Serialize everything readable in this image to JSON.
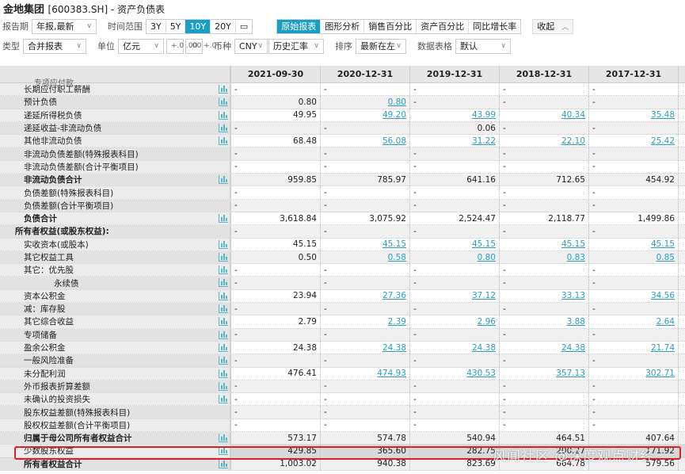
{
  "header": {
    "company": "金地集团",
    "code": "[600383.SH] - 资产负债表"
  },
  "toolbar1": {
    "period_label": "报告期",
    "period_value": "年报,最新",
    "range_label": "时间范围",
    "ranges": [
      "3Y",
      "5Y",
      "10Y",
      "20Y"
    ],
    "active_range": "10Y",
    "views": [
      "原始报表",
      "图形分析",
      "销售百分比",
      "资产百分比",
      "同比增长率"
    ],
    "active_view": "原始报表",
    "collapse": "收起"
  },
  "toolbar2": {
    "type_label": "类型",
    "type_value": "合并报表",
    "unit_label": "单位",
    "unit_value": "亿元",
    "dec_inc": "+.0 .00",
    "dec_dec": ".00 +.0",
    "currency_label": "币种",
    "currency_value": "CNY",
    "rate_value": "历史汇率",
    "sort_label": "排序",
    "sort_value": "最新在左",
    "format_label": "数据表格",
    "format_value": "默认"
  },
  "columns": [
    "2021-09-30",
    "2020-12-31",
    "2019-12-31",
    "2018-12-31",
    "2017-12-31"
  ],
  "partial_row": "专项应付款",
  "rows": [
    {
      "label": "长期应付职工薪酬",
      "icon": true,
      "values": [
        "-",
        "-",
        "-",
        "-",
        "-"
      ]
    },
    {
      "label": "预计负债",
      "icon": true,
      "values": [
        "0.80",
        "0.80",
        "-",
        "-",
        "-"
      ]
    },
    {
      "label": "递延所得税负债",
      "icon": true,
      "values": [
        "49.95",
        "49.20",
        "43.99",
        "40.34",
        "35.48"
      ]
    },
    {
      "label": "递延收益-非流动负债",
      "icon": true,
      "values": [
        "-",
        "-",
        "0.06",
        "-",
        "-"
      ]
    },
    {
      "label": "其他非流动负债",
      "icon": true,
      "values": [
        "68.48",
        "56.08",
        "31.22",
        "22.10",
        "25.42"
      ]
    },
    {
      "label": "非流动负债差额(特殊报表科目)",
      "icon": false,
      "values": [
        "-",
        "-",
        "-",
        "-",
        "-"
      ]
    },
    {
      "label": "非流动负债差额(合计平衡项目)",
      "icon": false,
      "values": [
        "-",
        "-",
        "-",
        "-",
        "-"
      ]
    },
    {
      "label": "非流动负债合计",
      "icon": true,
      "bold": true,
      "values": [
        "959.85",
        "785.97",
        "641.16",
        "712.65",
        "454.92"
      ]
    },
    {
      "label": "负债差额(特殊报表科目)",
      "icon": false,
      "values": [
        "-",
        "-",
        "-",
        "-",
        "-"
      ]
    },
    {
      "label": "负债差额(合计平衡项目)",
      "icon": false,
      "values": [
        "-",
        "-",
        "-",
        "-",
        "-"
      ]
    },
    {
      "label": "负债合计",
      "icon": true,
      "bold": true,
      "values": [
        "3,618.84",
        "3,075.92",
        "2,524.47",
        "2,118.77",
        "1,499.86"
      ]
    },
    {
      "label": "所有者权益(或股东权益):",
      "icon": false,
      "section": true,
      "values": [
        "-",
        "-",
        "-",
        "-",
        "-"
      ]
    },
    {
      "label": "实收资本(或股本)",
      "icon": true,
      "values": [
        "45.15",
        "45.15",
        "45.15",
        "45.15",
        "45.15"
      ]
    },
    {
      "label": "其它权益工具",
      "icon": true,
      "values": [
        "0.50",
        "0.58",
        "0.80",
        "0.83",
        "0.85"
      ]
    },
    {
      "label": "其它：优先股",
      "icon": true,
      "values": [
        "-",
        "-",
        "-",
        "-",
        "-"
      ]
    },
    {
      "label": "永续债",
      "icon": true,
      "indent": true,
      "values": [
        "-",
        "-",
        "-",
        "-",
        "-"
      ]
    },
    {
      "label": "资本公积金",
      "icon": true,
      "values": [
        "23.94",
        "27.36",
        "37.12",
        "33.13",
        "34.56"
      ]
    },
    {
      "label": "减：库存股",
      "icon": true,
      "values": [
        "-",
        "-",
        "-",
        "-",
        "-"
      ]
    },
    {
      "label": "其它综合收益",
      "icon": true,
      "values": [
        "2.79",
        "2.39",
        "2.96",
        "3.88",
        "2.64"
      ]
    },
    {
      "label": "专项储备",
      "icon": true,
      "values": [
        "-",
        "-",
        "-",
        "-",
        "-"
      ]
    },
    {
      "label": "盈余公积金",
      "icon": true,
      "values": [
        "24.38",
        "24.38",
        "24.38",
        "24.38",
        "21.74"
      ]
    },
    {
      "label": "一般风险准备",
      "icon": true,
      "values": [
        "-",
        "-",
        "-",
        "-",
        "-"
      ]
    },
    {
      "label": "未分配利润",
      "icon": true,
      "values": [
        "476.41",
        "474.93",
        "430.53",
        "357.13",
        "302.71"
      ]
    },
    {
      "label": "外币报表折算差额",
      "icon": true,
      "values": [
        "-",
        "-",
        "-",
        "-",
        "-"
      ]
    },
    {
      "label": "未确认的投资损失",
      "icon": true,
      "values": [
        "-",
        "-",
        "-",
        "-",
        "-"
      ]
    },
    {
      "label": "股东权益差额(特殊报表科目)",
      "icon": false,
      "values": [
        "-",
        "-",
        "-",
        "-",
        "-"
      ]
    },
    {
      "label": "股权权益差额(合计平衡项目)",
      "icon": false,
      "values": [
        "-",
        "-",
        "-",
        "-",
        "-"
      ]
    },
    {
      "label": "归属于母公司所有者权益合计",
      "icon": true,
      "bold": true,
      "values": [
        "573.17",
        "574.78",
        "540.94",
        "464.51",
        "407.64"
      ]
    },
    {
      "label": "少数股东权益",
      "icon": true,
      "highlight": true,
      "values": [
        "429.85",
        "365.60",
        "282.75",
        "200.27",
        "171.92"
      ]
    },
    {
      "label": "所有者权益合计",
      "icon": true,
      "bold": true,
      "values": [
        "1,003.02",
        "940.38",
        "823.69",
        "664.78",
        "579.56"
      ]
    }
  ],
  "watermark": "风闻社区 @深度观点财经",
  "colors": {
    "accent": "#1a9ec4",
    "link": "#2a9ec0",
    "highlight": "#e02020"
  }
}
